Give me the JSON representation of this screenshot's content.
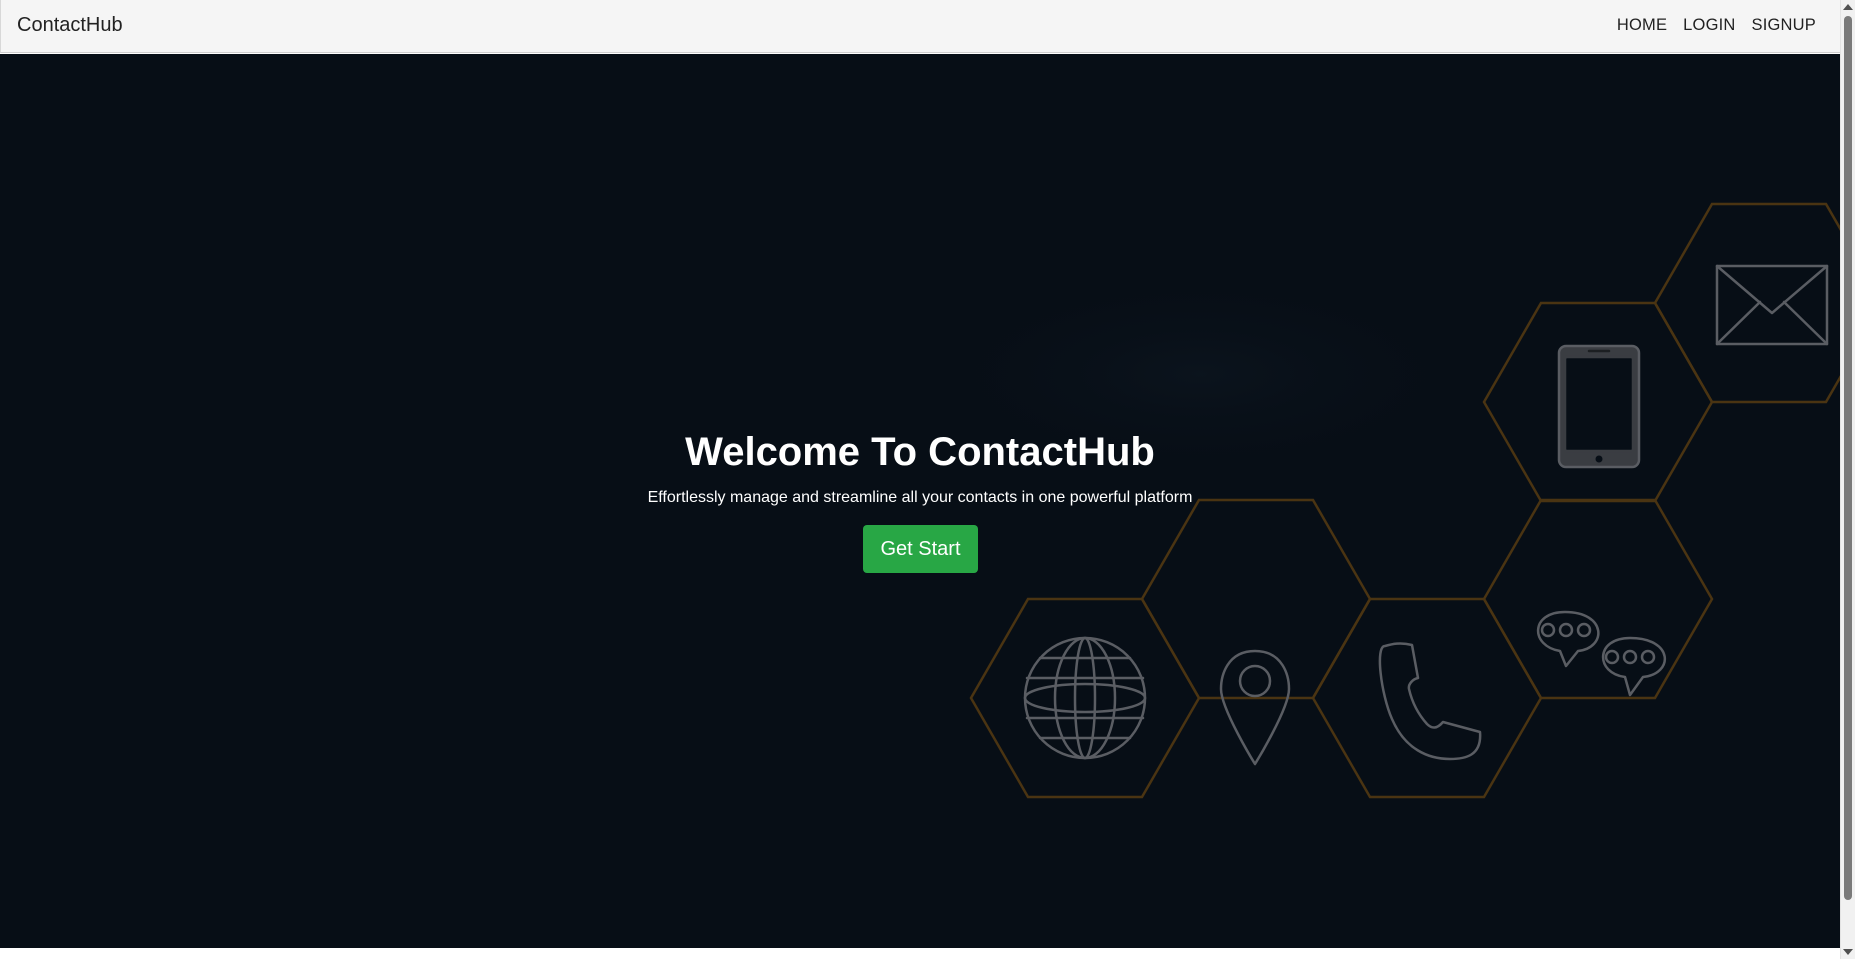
{
  "navbar": {
    "brand": "ContactHub",
    "links": [
      {
        "label": "HOME"
      },
      {
        "label": "LOGIN"
      },
      {
        "label": "SIGNUP"
      }
    ]
  },
  "hero": {
    "title": "Welcome To ContactHub",
    "subtitle": "Effortlessly manage and streamline all your contacts in one powerful platform",
    "cta_label": "Get Start",
    "background_color": "#070e16",
    "hex_border_color": "#4a3412",
    "icon_stroke_color": "#5a5d63",
    "illustration_icons": [
      "globe-icon",
      "location-pin-icon",
      "phone-icon",
      "chat-bubbles-icon",
      "tablet-icon",
      "envelope-icon"
    ]
  },
  "colors": {
    "cta": "#28a745",
    "navbar": "#f5f5f5"
  }
}
